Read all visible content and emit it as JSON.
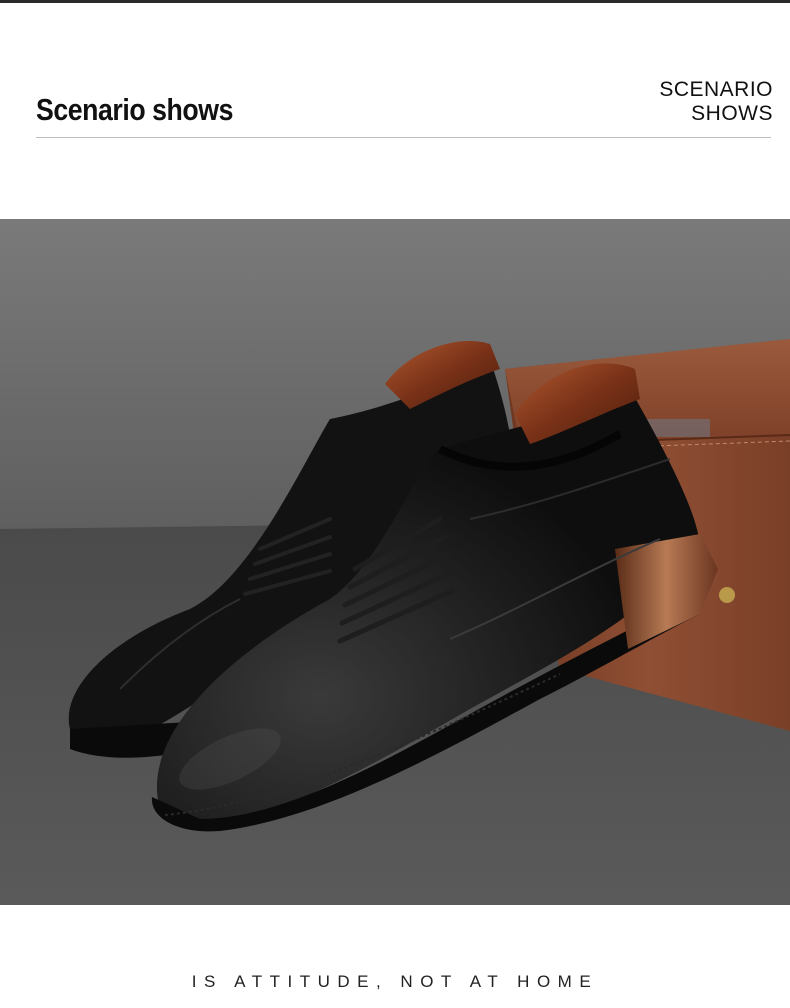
{
  "header": {
    "title": "Scenario shows",
    "label_line1": "SCENARIO",
    "label_line2": "SHOWS"
  },
  "photo": {
    "subject": "black-leather-derby-shoes-pair",
    "props": [
      "wooden-shoe-trees",
      "brown-leather-box"
    ]
  },
  "footer": {
    "tagline": "IS ATTITUDE, NOT AT HOME"
  },
  "colors": {
    "text": "#111111",
    "divider": "#bdbdbd",
    "wall": "#6e6e6e",
    "floor": "#555555",
    "leather": "#141414",
    "wood": "#8b3f22",
    "box": "#8a4a30"
  }
}
